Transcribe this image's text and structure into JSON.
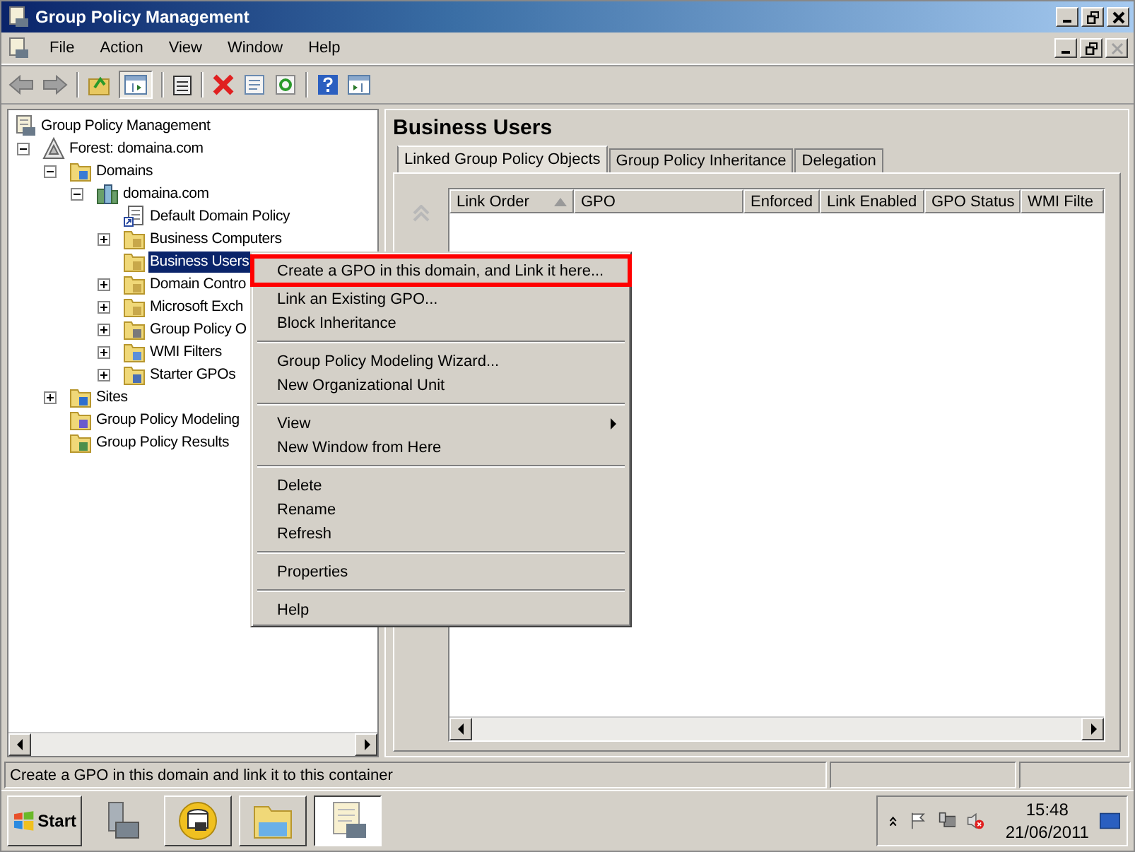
{
  "window": {
    "title": "Group Policy Management",
    "child_close_enabled": false
  },
  "menu_bar": [
    "File",
    "Action",
    "View",
    "Window",
    "Help"
  ],
  "tree": [
    {
      "label": "Group Policy Management",
      "kind": "console",
      "selected": false,
      "children": [
        {
          "label": "Forest: domaina.com",
          "kind": "forest",
          "expanded": true,
          "selected": false,
          "children": [
            {
              "label": "Domains",
              "kind": "domains",
              "expanded": true,
              "selected": false,
              "children": [
                {
                  "label": "domaina.com",
                  "kind": "domain",
                  "expanded": true,
                  "selected": false,
                  "children": [
                    {
                      "label": "Default Domain Policy",
                      "kind": "link",
                      "selected": false
                    },
                    {
                      "label": "Business Computers",
                      "kind": "ou",
                      "expanded": false,
                      "selected": false
                    },
                    {
                      "label": "Business Users",
                      "kind": "ou",
                      "selected": true
                    },
                    {
                      "label": "Domain Contro",
                      "kind": "ou",
                      "expanded": false,
                      "selected": false
                    },
                    {
                      "label": "Microsoft Exch",
                      "kind": "ou",
                      "expanded": false,
                      "selected": false
                    },
                    {
                      "label": "Group Policy O",
                      "kind": "gpos",
                      "expanded": false,
                      "selected": false
                    },
                    {
                      "label": "WMI Filters",
                      "kind": "wmi",
                      "expanded": false,
                      "selected": false
                    },
                    {
                      "label": "Starter GPOs",
                      "kind": "starter",
                      "expanded": false,
                      "selected": false
                    }
                  ]
                }
              ]
            },
            {
              "label": "Sites",
              "kind": "sites",
              "expanded": false,
              "selected": false
            },
            {
              "label": "Group Policy Modeling",
              "kind": "modeling",
              "selected": false
            },
            {
              "label": "Group Policy Results",
              "kind": "results",
              "selected": false
            }
          ]
        }
      ]
    }
  ],
  "pane_title": "Business Users",
  "tabs": [
    {
      "label": "Linked Group Policy Objects",
      "selected": true
    },
    {
      "label": "Group Policy Inheritance",
      "selected": false
    },
    {
      "label": "Delegation",
      "selected": false
    }
  ],
  "columns": [
    {
      "label": "Link Order",
      "sorted": true
    },
    {
      "label": "GPO",
      "sorted": false
    },
    {
      "label": "Enforced",
      "sorted": false
    },
    {
      "label": "Link Enabled",
      "sorted": false
    },
    {
      "label": "GPO Status",
      "sorted": false
    },
    {
      "label": "WMI Filte",
      "sorted": false
    }
  ],
  "context_menu": [
    [
      {
        "label": "Create a GPO in this domain, and Link it here...",
        "highlighted": true,
        "submenu": false
      },
      {
        "label": "Link an Existing GPO...",
        "highlighted": false,
        "submenu": false
      },
      {
        "label": "Block Inheritance",
        "highlighted": false,
        "submenu": false
      }
    ],
    [
      {
        "label": "Group Policy Modeling Wizard...",
        "highlighted": false,
        "submenu": false
      },
      {
        "label": "New Organizational Unit",
        "highlighted": false,
        "submenu": false
      }
    ],
    [
      {
        "label": "View",
        "highlighted": false,
        "submenu": true
      },
      {
        "label": "New Window from Here",
        "highlighted": false,
        "submenu": false
      }
    ],
    [
      {
        "label": "Delete",
        "highlighted": false,
        "submenu": false
      },
      {
        "label": "Rename",
        "highlighted": false,
        "submenu": false
      },
      {
        "label": "Refresh",
        "highlighted": false,
        "submenu": false
      }
    ],
    [
      {
        "label": "Properties",
        "highlighted": false,
        "submenu": false
      }
    ],
    [
      {
        "label": "Help",
        "highlighted": false,
        "submenu": false
      }
    ]
  ],
  "status_bar": {
    "text": "Create a GPO in this domain and link it to this container"
  },
  "taskbar": {
    "start": "Start",
    "buttons": [
      {
        "kind": "server",
        "active": false
      },
      {
        "kind": "drive",
        "active": false
      },
      {
        "kind": "explorer",
        "active": false
      },
      {
        "kind": "policy",
        "active": true
      }
    ],
    "time": "15:48",
    "date": "21/06/2011"
  }
}
